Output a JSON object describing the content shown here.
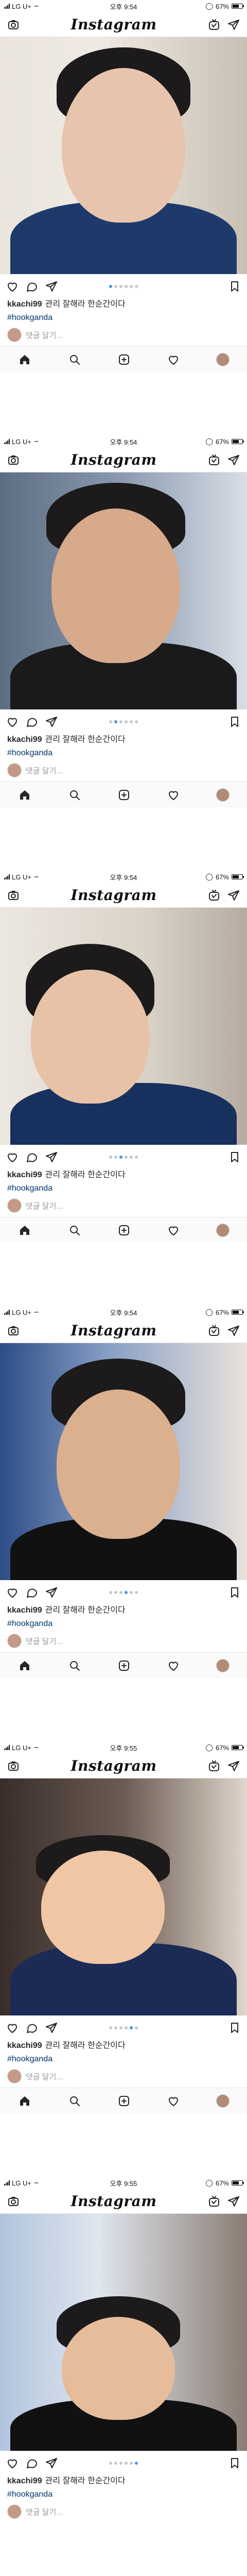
{
  "status_bar": {
    "carrier": "LG U+",
    "times": [
      "오후 9:54",
      "오후 9:54",
      "오후 9:54",
      "오후 9:54",
      "오후 9:55",
      "오후 9:55"
    ],
    "battery_text": "67%",
    "battery_level": 0.67
  },
  "header": {
    "logo": "Instagram",
    "camera_icon": "camera-icon",
    "igtv_icon": "igtv-icon",
    "direct_icon": "direct-message-icon"
  },
  "post": {
    "username": "kkachi99",
    "caption_text": "관리 잘해라 한순간이다",
    "hashtag": "#hookganda",
    "comment_placeholder": "댓글 달기...",
    "carousel_count": 6,
    "active_slides": [
      1,
      2,
      3,
      4,
      5,
      6
    ]
  },
  "tabbar": {
    "items": [
      "home-icon",
      "search-icon",
      "add-post-icon",
      "activity-heart-icon",
      "profile-avatar"
    ]
  },
  "colors": {
    "accent": "#3897f0",
    "hashtag": "#003569",
    "muted": "#999999"
  }
}
